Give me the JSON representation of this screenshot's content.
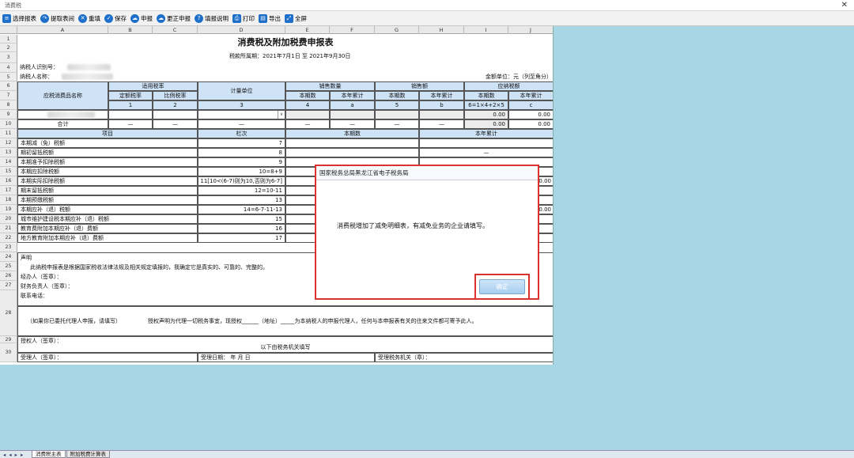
{
  "window": {
    "title": "消费税",
    "close": "✕"
  },
  "toolbar": [
    {
      "name": "select-report",
      "label": "选择报表",
      "icon": "list-icon"
    },
    {
      "name": "fetch-table",
      "label": "提取表间",
      "icon": "arrow-icon"
    },
    {
      "name": "refill",
      "label": "重填",
      "icon": "close-icon"
    },
    {
      "name": "save",
      "label": "保存",
      "icon": "check-icon"
    },
    {
      "name": "declare",
      "label": "申报",
      "icon": "cloud-icon"
    },
    {
      "name": "correct-declare",
      "label": "更正申报",
      "icon": "cloud-icon"
    },
    {
      "name": "fill-instructions",
      "label": "填报说明",
      "icon": "help-icon"
    },
    {
      "name": "print",
      "label": "打印",
      "icon": "printer-icon"
    },
    {
      "name": "export",
      "label": "导出",
      "icon": "document-icon"
    },
    {
      "name": "fullscreen",
      "label": "全屏",
      "icon": "expand-icon"
    }
  ],
  "columns": [
    "A",
    "B",
    "C",
    "D",
    "E",
    "F",
    "G",
    "H",
    "I",
    "J"
  ],
  "rows": [
    "1",
    "2",
    "3",
    "4",
    "5",
    "6",
    "7",
    "8",
    "9",
    "10",
    "11",
    "12",
    "13",
    "14",
    "15",
    "16",
    "17",
    "18",
    "19",
    "20",
    "21",
    "22",
    "23",
    "24",
    "25",
    "26",
    "27",
    "28",
    "29",
    "30"
  ],
  "form": {
    "title": "消费税及附加税费申报表",
    "period_label": "税款所属期：",
    "period_value": "2021年7月1日 至 2021年9月30日",
    "taxpayer_id_label": "纳税人识别号：",
    "taxpayer_name_label": "纳税人名称：",
    "unit_label": "金额单位：元（列至角分）",
    "h_item_name": "应税消费品名称",
    "h_rate": "适用税率",
    "h_rate_fixed": "定额税率",
    "h_rate_prop": "比例税率",
    "h_unit": "计量单位",
    "h_qty": "销售数量",
    "h_amt": "销售额",
    "h_tax": "应纳税额",
    "h_cur": "本期数",
    "h_ytd": "本年累计",
    "idx": [
      "1",
      "2",
      "3",
      "4",
      "a",
      "5",
      "b",
      "6=1×4+2×5",
      "c"
    ],
    "row8_i": "0.00",
    "row8_j": "0.00",
    "total_label": "合计",
    "dash": "—",
    "total_i": "0.00",
    "total_j": "0.00",
    "sec_item": "项目",
    "sec_line": "栏次",
    "sec_cur": "本期数",
    "sec_ytd": "本年累计",
    "items": [
      {
        "label": "本期减（免）税额",
        "line": "7"
      },
      {
        "label": "期初留抵税额",
        "line": "8"
      },
      {
        "label": "本期准予扣除税额",
        "line": "9"
      },
      {
        "label": "本期应扣除税额",
        "line": "10=8+9"
      },
      {
        "label": "本期实际扣除税额",
        "line": "11[10<(6-7)则为10,否则为6-7]"
      },
      {
        "label": "期末留抵税额",
        "line": "12=10-11"
      },
      {
        "label": "本期预缴税额",
        "line": "13"
      },
      {
        "label": "本期应补（退）税额",
        "line": "14=6-7-11-13"
      },
      {
        "label": "城市维护建设税本期应补（退）税额",
        "line": "15"
      },
      {
        "label": "教育费附加本期应补（退）费额",
        "line": "16"
      },
      {
        "label": "地方教育附加本期应补（退）费额",
        "line": "17"
      }
    ],
    "r12_ytd": "—",
    "r15_j": "0.00",
    "r18_j": "0.00",
    "decl_label": "声明",
    "decl_text": "此纳税申报表是根据国家税收法律法规及相关规定填报的，我确定它是真实的、可靠的、完整的。",
    "agent": "经办人（签章）：",
    "finance": "财务负责人（签章）：",
    "phone": "联系电话：",
    "r27a": "（如果你已委托代理人申报，请填写）",
    "r27b": "授权声明为代理一切税务事宜，现授权______（地址）_____为本纳税人的申报代理人，任何与本申报表有关的往来文件都可寄予此人。",
    "r28": "授权人（签章）：",
    "r29": "以下由税务机关填写",
    "r30a": "受理人（签章）：",
    "r30b": "受理日期：    年    月    日",
    "r30c": "受理税务机关（章）："
  },
  "tabs": {
    "nav": "◂ ◂ ▸ ▸",
    "main": "消费税主表",
    "calc": "附加税费计算表"
  },
  "modal": {
    "header": "国家税务总局黑龙江省电子税务局",
    "message": "消费税增加了减免明细表，有减免业务的企业请填写。",
    "ok": "确定"
  }
}
